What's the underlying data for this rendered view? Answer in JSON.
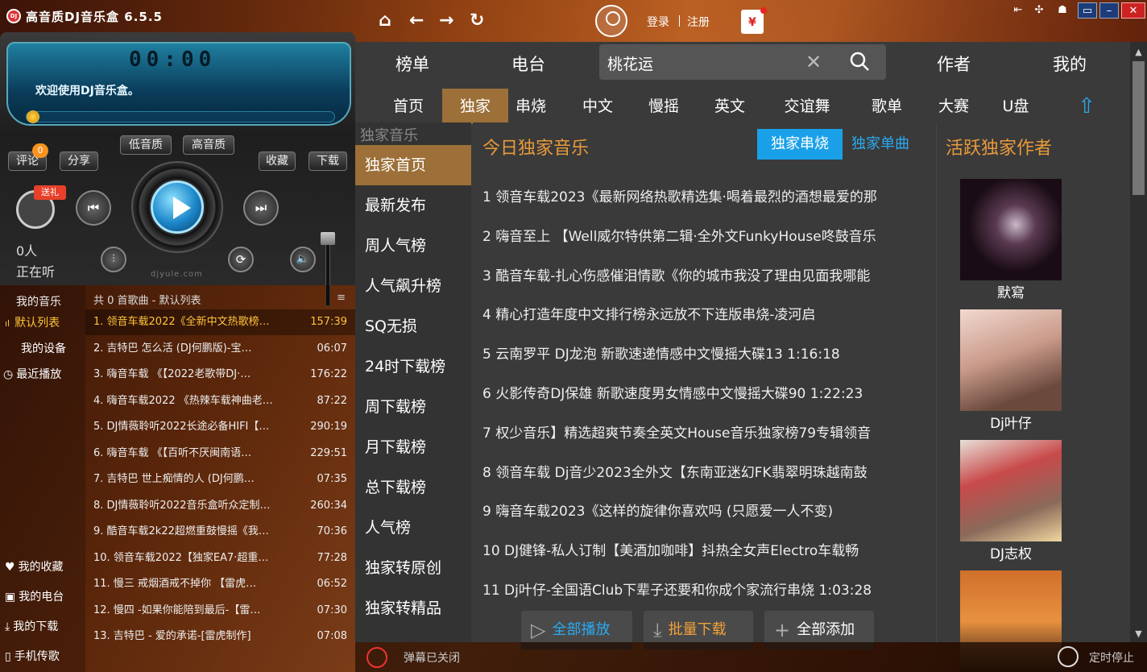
{
  "app": {
    "title": "高音质DJ音乐盒 6.5.5",
    "logo": "DJ"
  },
  "header": {
    "login": "登录",
    "register": "注册",
    "gift": "¥"
  },
  "player": {
    "time": "00:00",
    "welcome": "欢迎使用DJ音乐盒。",
    "progress": 0,
    "buttons": {
      "low_quality": "低音质",
      "high_quality": "高音质",
      "comment": "评论",
      "comment_count": "0",
      "share": "分享",
      "favorite": "收藏",
      "download": "下载",
      "send_gift": "送礼"
    },
    "listeners_count": "0人",
    "listeners_label": "正在听",
    "brand": "djyule.com"
  },
  "left_nav": {
    "my_music": "我的音乐",
    "default_list": "默认列表",
    "my_device": "我的设备",
    "recent": "最近播放",
    "my_favorites": "我的收藏",
    "my_radio": "我的电台",
    "my_downloads": "我的下载",
    "phone_transfer": "手机传歌"
  },
  "playlist": {
    "header": "共 0 首歌曲 - 默认列表",
    "songs": [
      {
        "title": "1. 领音车载2022《全新中文热歌榜…",
        "duration": "157:39"
      },
      {
        "title": "2. 吉特巴  怎么活 (DJ何鹏版)-宝…",
        "duration": "06:07"
      },
      {
        "title": "3. 嗨音车载 《【2022老歌带DJ·…",
        "duration": "176:22"
      },
      {
        "title": "4. 嗨音车载2022 《热辣车载神曲老…",
        "duration": "87:22"
      },
      {
        "title": "5. DJ情薇聆听2022长途必备HIFI【…",
        "duration": "290:19"
      },
      {
        "title": "6. 嗨音车载 《【百听不厌闽南语…",
        "duration": "229:51"
      },
      {
        "title": "7. 吉特巴  世上痴情的人 (DJ何鹏…",
        "duration": "07:35"
      },
      {
        "title": "8. DJ情薇聆听2022音乐盒听众定制…",
        "duration": "260:34"
      },
      {
        "title": "9. 酷音车载2k22超燃重鼓慢摇《我…",
        "duration": "70:36"
      },
      {
        "title": "10. 领音车载2022【独家EA7·超重…",
        "duration": "77:28"
      },
      {
        "title": "11. 慢三  戒烟酒戒不掉你 【雷虎…",
        "duration": "06:52"
      },
      {
        "title": "12. 慢四 -如果你能陪到最后-【雷…",
        "duration": "07:30"
      },
      {
        "title": "13. 吉特巴 - 爱的承诺-[雷虎制作]",
        "duration": "07:08"
      }
    ]
  },
  "top_tabs": {
    "charts": "榜单",
    "radio": "电台",
    "artist": "作者",
    "mine": "我的"
  },
  "search": {
    "value": "桃花运"
  },
  "sub_tabs": [
    "首页",
    "独家",
    "串烧",
    "中文",
    "慢摇",
    "英文",
    "交谊舞",
    "歌单",
    "大赛",
    "U盘"
  ],
  "categories": {
    "title": "独家音乐",
    "items": [
      "独家首页",
      "最新发布",
      "周人气榜",
      "人气飙升榜",
      "SQ无损",
      "24时下载榜",
      "周下载榜",
      "月下载榜",
      "总下载榜",
      "人气榜",
      "独家转原创",
      "独家转精品"
    ]
  },
  "content": {
    "title": "今日独家音乐",
    "toggle_medley": "独家串烧",
    "toggle_single": "独家单曲",
    "tracks": [
      "1  领音车载2023《最新网络热歌精选集·喝着最烈的酒想最爱的那",
      "2  嗨音至上 【Well威尔特供第二辑·全外文FunkyHouse咚鼓音乐",
      "3  酷音车载-扎心伤感催泪情歌《你的城市我没了理由见面我哪能",
      "4  精心打造年度中文排行榜永远放不下连版串烧-凌河启",
      "5  云南罗平 DJ龙泡 新歌速递情感中文慢摇大碟13  1:16:18",
      "6  火影传奇DJ保雄 新歌速度男女情感中文慢摇大碟90  1:22:23",
      "7  权少音乐】精选超爽节奏全英文House音乐独家榜79专辑领音",
      "8  领音车载 Dj音少2023全外文【东南亚迷幻FK翡翠明珠越南鼓",
      "9  嗨音车载2023《这样的旋律你喜欢吗 (只愿爱一人不变)",
      "10  DJ健锋-私人订制【美酒加咖啡】抖热全女声Electro车载畅",
      "11  Dj叶仔-全国语Club下辈子还要和你成个家流行串烧  1:03:28"
    ],
    "play_all": "全部播放",
    "batch_download": "批量下载",
    "add_all": "全部添加"
  },
  "artists": {
    "title": "活跃独家作者",
    "items": [
      {
        "name": "默寫"
      },
      {
        "name": "Dj叶仔"
      },
      {
        "name": "DJ志权"
      },
      {
        "name": ""
      }
    ]
  },
  "status": {
    "danmu": "弹幕已关闭",
    "timer": "定时停止"
  }
}
